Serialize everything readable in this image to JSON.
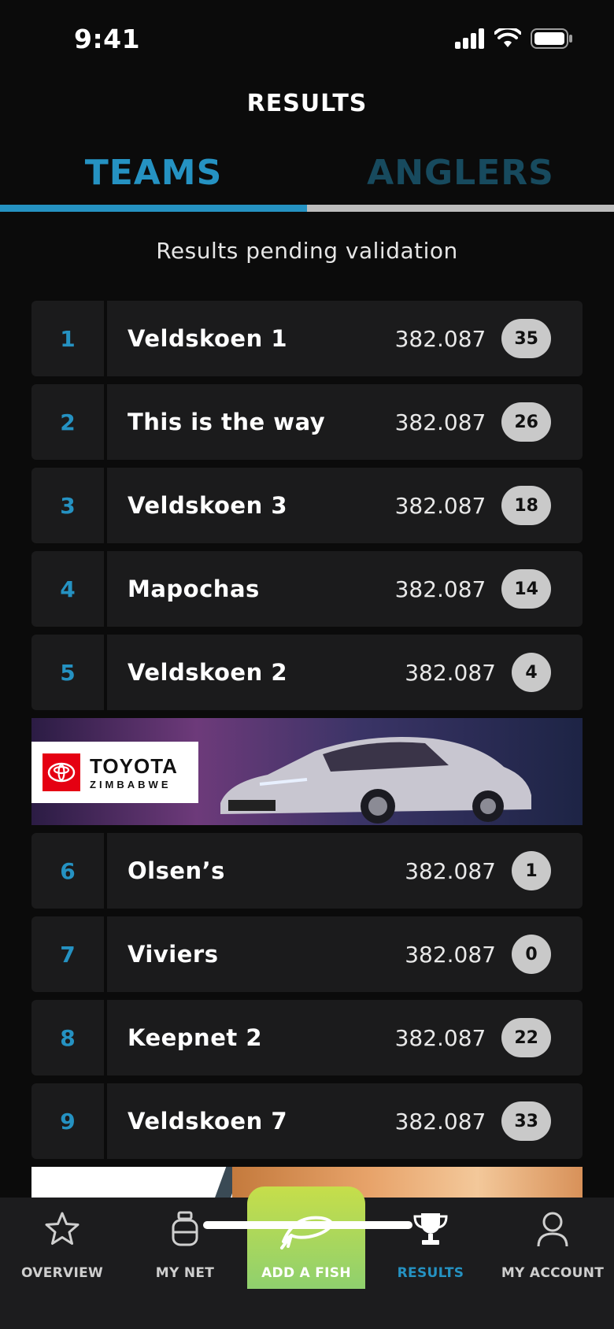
{
  "status_bar": {
    "time": "9:41"
  },
  "header": {
    "title": "RESULTS"
  },
  "tabs": [
    {
      "label": "TEAMS",
      "active": true
    },
    {
      "label": "ANGLERS",
      "active": false
    }
  ],
  "notice": "Results pending validation",
  "rows": [
    {
      "rank": "1",
      "name": "Veldskoen 1",
      "score": "382.087",
      "count": "35"
    },
    {
      "rank": "2",
      "name": "This is the way",
      "score": "382.087",
      "count": "26"
    },
    {
      "rank": "3",
      "name": "Veldskoen 3",
      "score": "382.087",
      "count": "18"
    },
    {
      "rank": "4",
      "name": "Mapochas",
      "score": "382.087",
      "count": "14"
    },
    {
      "rank": "5",
      "name": "Veldskoen 2",
      "score": "382.087",
      "count": "4"
    },
    {
      "rank": "6",
      "name": "Olsen’s",
      "score": "382.087",
      "count": "1"
    },
    {
      "rank": "7",
      "name": "Viviers",
      "score": "382.087",
      "count": "0"
    },
    {
      "rank": "8",
      "name": "Keepnet 2",
      "score": "382.087",
      "count": "22"
    },
    {
      "rank": "9",
      "name": "Veldskoen 7",
      "score": "382.087",
      "count": "33"
    }
  ],
  "ad": {
    "brand": "TOYOTA",
    "country": "ZIMBABWE"
  },
  "nav": {
    "overview": "OVERVIEW",
    "my_net": "MY NET",
    "add_fish": "ADD A FISH",
    "results": "RESULTS",
    "my_account": "MY ACCOUNT"
  },
  "colors": {
    "accent": "#2592c2",
    "inactive_tab": "#174a5e",
    "add_fish_gradient_top": "#c6de4a",
    "add_fish_gradient_bottom": "#8fd06e"
  }
}
